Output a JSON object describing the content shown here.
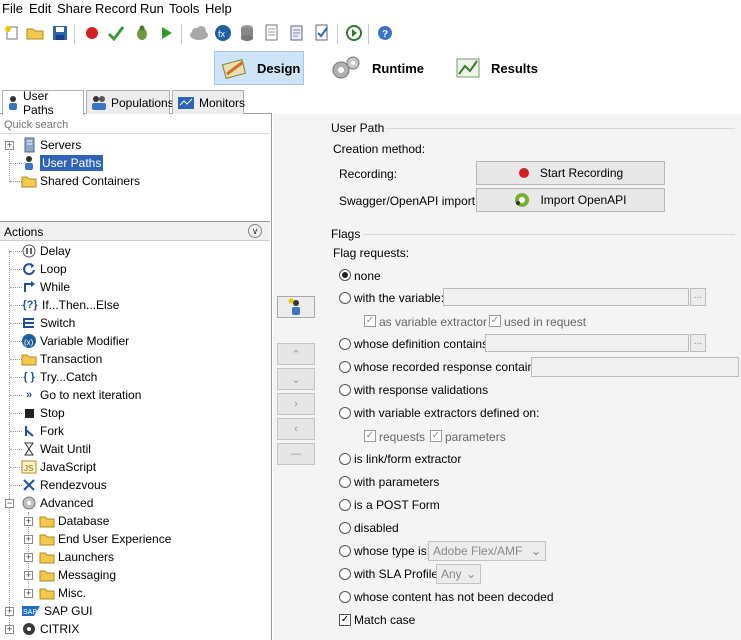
{
  "menu": [
    "File",
    "Edit",
    "Share",
    "Record",
    "Run",
    "Tools",
    "Help"
  ],
  "modes": {
    "design": "Design",
    "runtime": "Runtime",
    "results": "Results"
  },
  "tabs": {
    "user_paths": "User Paths",
    "populations": "Populations",
    "monitors": "Monitors"
  },
  "search": {
    "placeholder": "Quick search"
  },
  "tree": {
    "servers": "Servers",
    "user_paths": "User Paths",
    "shared_containers": "Shared Containers"
  },
  "actions": {
    "header": "Actions",
    "items": [
      "Delay",
      "Loop",
      "While",
      "If...Then...Else",
      "Switch",
      "Variable Modifier",
      "Transaction",
      "Try...Catch",
      "Go to next iteration",
      "Stop",
      "Fork",
      "Wait Until",
      "JavaScript",
      "Rendezvous",
      "Advanced"
    ],
    "advanced_children": [
      "Database",
      "End User Experience",
      "Launchers",
      "Messaging",
      "Misc."
    ],
    "more": [
      "SAP GUI",
      "CITRIX"
    ]
  },
  "user_path": {
    "section": "User Path",
    "creation_method": "Creation method:",
    "recording_label": "Recording:",
    "start_recording": "Start Recording",
    "swagger_label": "Swagger/OpenAPI import:",
    "import_openapi": "Import OpenAPI"
  },
  "flags": {
    "section": "Flags",
    "flag_requests": "Flag requests:",
    "none": "none",
    "with_variable": "with the variable:",
    "as_variable_extractor": "as variable extractor",
    "used_in_request": "used in request",
    "whose_definition": "whose definition contains:",
    "whose_recorded": "whose recorded response contains:",
    "with_response_validations": "with response validations",
    "with_variable_extractors": "with variable extractors defined on:",
    "requests": "requests",
    "parameters_cb": "parameters",
    "is_link_form": "is link/form extractor",
    "with_parameters": "with parameters",
    "is_post_form": "is a POST Form",
    "disabled": "disabled",
    "whose_type": "whose type is:",
    "type_value": "Adobe Flex/AMF",
    "with_sla": "with SLA Profile:",
    "sla_value": "Any",
    "not_decoded": "whose content has not been decoded",
    "match_case": "Match case"
  },
  "colors": {
    "accent": "#cde4f7",
    "record_red": "#d32020"
  }
}
